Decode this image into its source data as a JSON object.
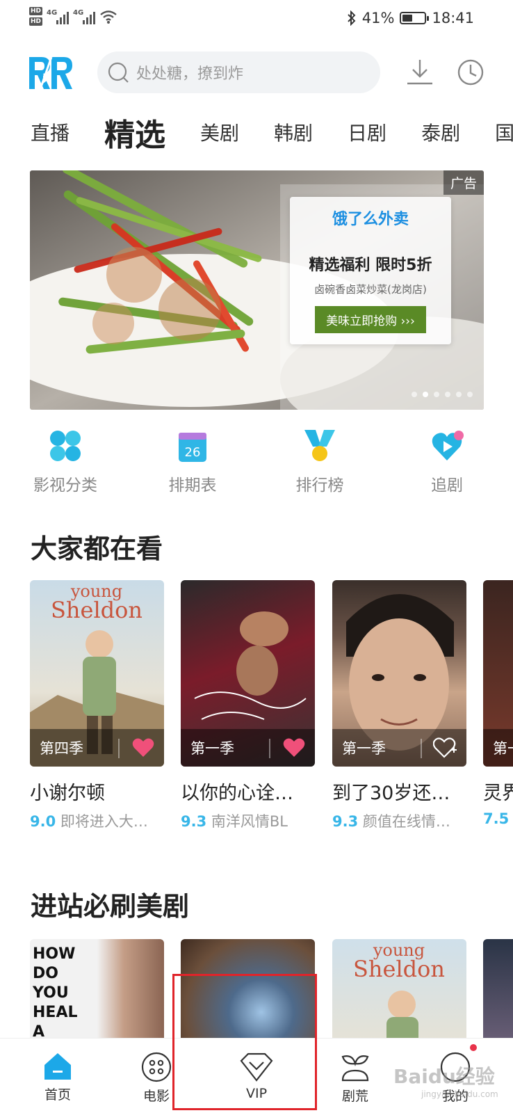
{
  "status_bar": {
    "hd1": "HD",
    "hd2": "HD",
    "net1": "4G",
    "net2": "4G",
    "battery_pct": "41%",
    "battery_level": 0.41,
    "time": "18:41"
  },
  "header": {
    "logo_text": "RR",
    "search_placeholder": "处处糖，撩到炸",
    "accent": "#1ca8e8"
  },
  "tabs": [
    "直播",
    "精选",
    "美剧",
    "韩剧",
    "日剧",
    "泰剧",
    "国"
  ],
  "active_tab": "精选",
  "banner": {
    "ad_label": "广告",
    "brand": "饿了么外卖",
    "headline": "精选福利 限时5折",
    "subline": "卤碗香卤菜炒菜(龙岗店)",
    "cta": "美味立即抢购 ›››"
  },
  "shortcuts": [
    {
      "label": "影视分类",
      "icon": "category-icon"
    },
    {
      "label": "排期表",
      "icon": "calendar-icon",
      "day": "26"
    },
    {
      "label": "排行榜",
      "icon": "ranking-medal-icon"
    },
    {
      "label": "追剧",
      "icon": "follow-play-icon"
    }
  ],
  "section1": {
    "title": "大家都在看",
    "cards": [
      {
        "season": "第四季",
        "title": "小谢尔顿",
        "score": "9.0",
        "desc": "即将进入大…",
        "poster_text_1": "young",
        "poster_text_2": "Sheldon",
        "fav": true
      },
      {
        "season": "第一季",
        "title": "以你的心诠…",
        "score": "9.3",
        "desc": "南洋风情BL",
        "fav": true
      },
      {
        "season": "第一季",
        "title": "到了30岁还…",
        "score": "9.3",
        "desc": "颜值在线情…",
        "fav": false
      },
      {
        "season": "第一",
        "title": "灵界",
        "score": "7.5",
        "desc": ""
      }
    ]
  },
  "section2": {
    "title": "进站必刷美剧",
    "poster1_text": "HOW DO YOU HEAL A WORLD TURNED UPSIDE",
    "poster3_text_1": "young",
    "poster3_text_2": "Sheldon"
  },
  "bottom_nav": [
    {
      "label": "首页",
      "icon": "home-icon",
      "active": true
    },
    {
      "label": "电影",
      "icon": "film-reel-icon"
    },
    {
      "label": "VIP",
      "icon": "diamond-icon"
    },
    {
      "label": "剧荒",
      "icon": "sprout-icon"
    },
    {
      "label": "我的",
      "icon": "profile-icon"
    }
  ],
  "watermark": {
    "main": "Baidu经验",
    "sub": "jingyan.baidu.com"
  }
}
